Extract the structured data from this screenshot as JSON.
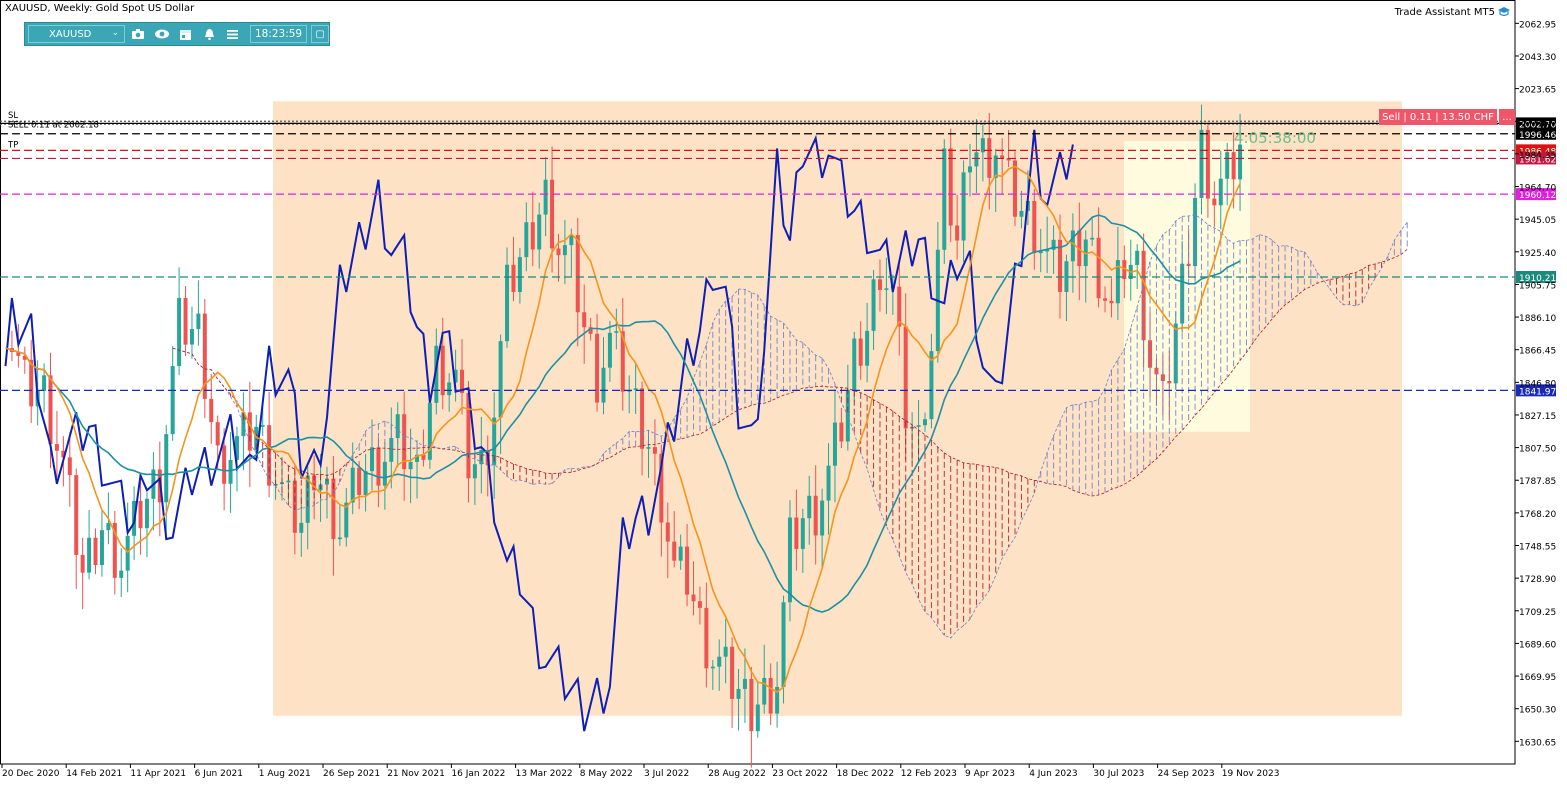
{
  "header": {
    "title": "XAUUSD, Weekly:  Gold Spot US Dollar",
    "trade_assistant": "Trade Assistant MT5"
  },
  "toolbar": {
    "symbol": "XAUUSD",
    "time": "18:23:59",
    "icons": [
      "camera-icon",
      "eye-icon",
      "calendar-icon",
      "alert-bell-icon",
      "menu-icon"
    ]
  },
  "order_panel": {
    "sell_label": "Sell | 0.11 | 13.50 CHF",
    "more_label": "..."
  },
  "chart_annotations": {
    "sl_label": "SL",
    "sell_label": "SELL 0.11 at 2002.18",
    "tp_label": "TP",
    "timer": "4:05:38:00"
  },
  "colors": {
    "bull": "#26a69a",
    "bear": "#ef5350",
    "tenkan": "#0d1fb5",
    "kijun": "#f7941d",
    "chikou": "#1e90a6",
    "kumo_bull": "#6f7fc9",
    "kumo_bear": "#b2182b",
    "range_box": "#fde0c2",
    "highlight_box": "#fffce0"
  },
  "chart_data": {
    "type": "candlestick",
    "symbol": "XAUUSD",
    "timeframe": "Weekly",
    "ylim": [
      1617,
      2077
    ],
    "price_ticks": [
      "2062.95",
      "2043.30",
      "2023.65",
      "2004.00",
      "1984.35",
      "1964.70",
      "1945.05",
      "1925.40",
      "1905.75",
      "1886.10",
      "1866.45",
      "1846.80",
      "1827.15",
      "1807.50",
      "1787.85",
      "1768.20",
      "1748.55",
      "1728.90",
      "1709.25",
      "1689.60",
      "1669.95",
      "1650.30",
      "1630.65"
    ],
    "date_ticks": [
      "20 Dec 2020",
      "14 Feb 2021",
      "11 Apr 2021",
      "6 Jun 2021",
      "1 Aug 2021",
      "26 Sep 2021",
      "21 Nov 2021",
      "16 Jan 2022",
      "13 Mar 2022",
      "8 May 2022",
      "3 Jul 2022",
      "28 Aug 2022",
      "23 Oct 2022",
      "18 Dec 2022",
      "12 Feb 2023",
      "9 Apr 2023",
      "4 Jun 2023",
      "30 Jul 2023",
      "24 Sep 2023",
      "19 Nov 2023"
    ],
    "level_lines": [
      {
        "name": "sl",
        "price": 2004.0,
        "style": "dotted",
        "color": "#555555"
      },
      {
        "name": "sell-entry",
        "price": 2002.18,
        "style": "dotted",
        "color": "#777777"
      },
      {
        "name": "bid",
        "price": 2002.7,
        "style": "solid",
        "color": "#000000",
        "label": "2002.70"
      },
      {
        "name": "ask",
        "price": 1996.46,
        "style": "dashed",
        "color": "#000000",
        "label": "1996.46"
      },
      {
        "name": "tp",
        "price": 1986.48,
        "style": "dashed",
        "color": "#e01010",
        "label": "1986.48"
      },
      {
        "name": "level-2",
        "price": 1981.62,
        "style": "dashed",
        "color": "#c21840",
        "label": "1981.62"
      },
      {
        "name": "magenta-level",
        "price": 1960.12,
        "style": "dashed",
        "color": "#e020e0",
        "label": "1960.12"
      },
      {
        "name": "teal-level",
        "price": 1910.21,
        "style": "dashed",
        "color": "#1a8a7a",
        "label": "1910.21"
      },
      {
        "name": "blue-level",
        "price": 1841.97,
        "style": "dashed",
        "color": "#1a2ab8",
        "label": "1841.97"
      }
    ]
  }
}
